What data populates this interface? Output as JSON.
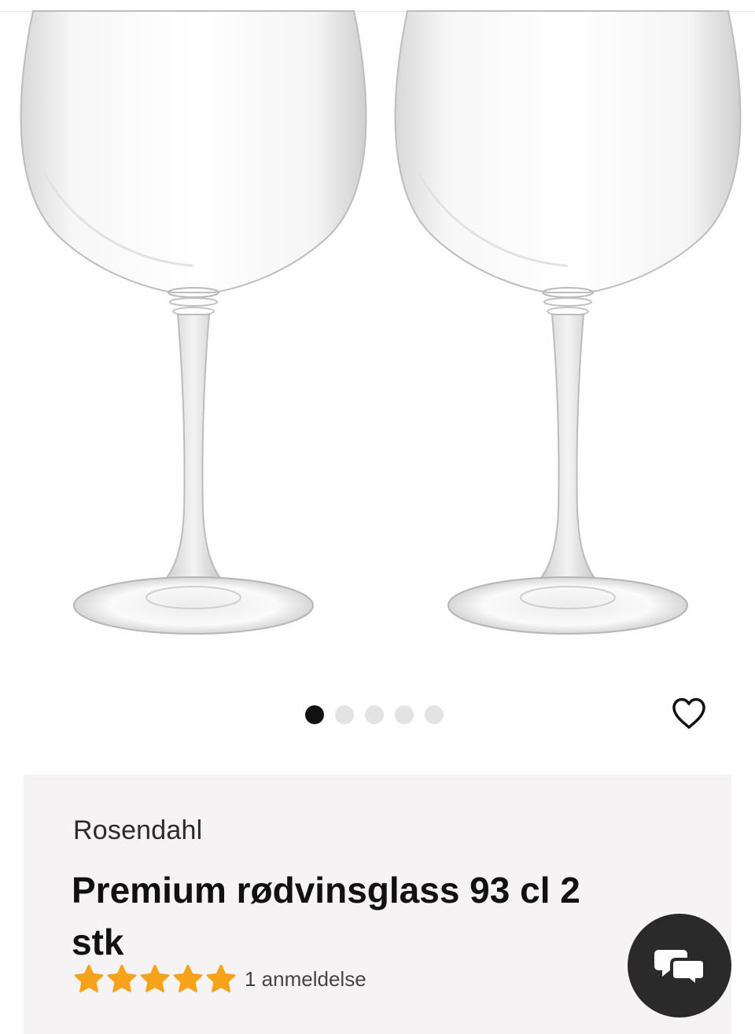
{
  "gallery": {
    "image": "product-image-two-red-wine-glasses",
    "slide_count": 5,
    "active_slide": 1
  },
  "favorite": {
    "icon": "heart-outline-icon"
  },
  "product": {
    "brand": "Rosendahl",
    "title": "Premium rødvinsglass 93 cl 2 stk",
    "rating": {
      "stars": 5,
      "max": 5,
      "star_color": "#f7a21b"
    },
    "reviews_label": "1 anmeldelse"
  },
  "chat": {
    "icon": "chat-bubbles-icon"
  },
  "colors": {
    "card_background": "#f5f3f3",
    "dot_active": "#111111",
    "dot_inactive": "#e3e3e3",
    "chat_button": "#2a2a2a"
  }
}
